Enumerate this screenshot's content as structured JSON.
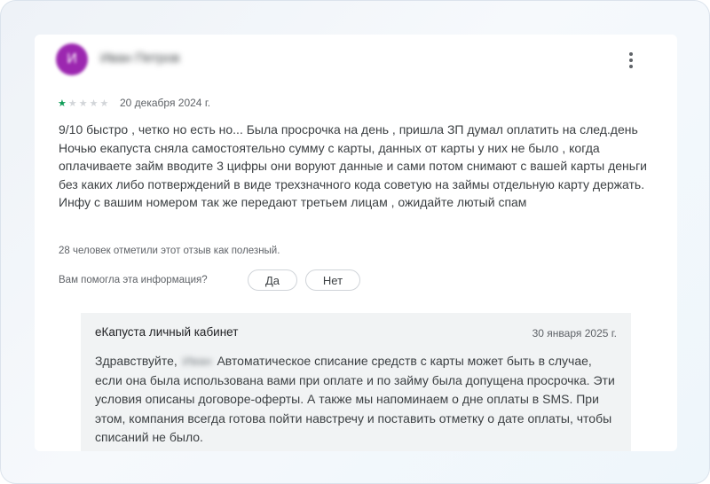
{
  "review": {
    "author_name": "Иван Петров",
    "avatar_initial": "И",
    "avatar_color": "#9c27b0",
    "rating": 1,
    "max_rating": 5,
    "date": "20 декабря 2024 г.",
    "text": "9/10 быстро , четко но есть но... Была просрочка на день , пришла ЗП думал оплатить на след.день Ночью екапуста сняла самостоятельно сумму с карты, данных от карты у них не было , когда оплачиваете займ вводите 3 цифры они воруют данные и сами потом снимают с вашей карты деньги без каких либо потверждений в виде трехзначного кода советую на займы отдельную карту держать. Инфу с вашим номером так же передают третьем лицам , ожидайте лютый спам",
    "helpful_count_text": "28 человек отметили этот отзыв как полезный.",
    "helpful_question": "Вам помогла эта информация?",
    "yes_label": "Да",
    "no_label": "Нет",
    "more_icon": "more-vertical-icon",
    "star_color": "#0f9d58"
  },
  "reply": {
    "author": "еКапуста личный кабинет",
    "date": "30 января 2025 г.",
    "greeting": "Здравствуйте,",
    "redacted_name": "Иван",
    "text": "Автоматическое списание средств с карты может быть в случае, если она была использована вами при оплате и по займу была допущена просрочка. Эти условия описаны договоре-оферты. А также мы напоминаем о дне оплаты в SMS. При этом, компания всегда готова пойти навстречу и поставить отметку о дате оплаты, чтобы списаний не было."
  }
}
